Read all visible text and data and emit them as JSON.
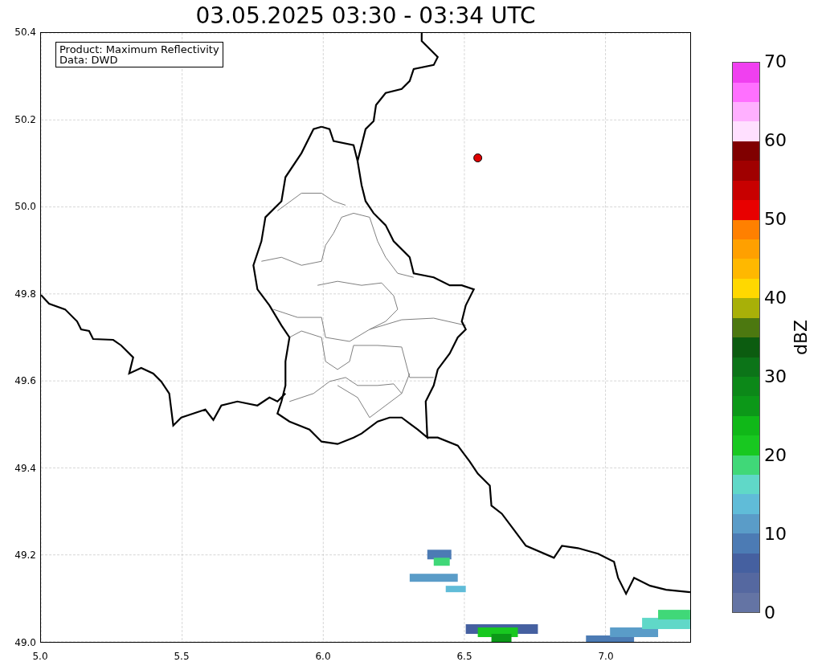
{
  "title": "03.05.2025 03:30 - 03:34 UTC",
  "map": {
    "legend": [
      "Product: Maximum Reflectivity",
      "Data: DWD"
    ],
    "xticks": [
      "5.0",
      "5.5",
      "6.0",
      "6.5",
      "7.0"
    ],
    "yticks": [
      "50.4",
      "50.2",
      "50.0",
      "49.8",
      "49.6",
      "49.4",
      "49.2",
      "49.0"
    ]
  },
  "colorbar": {
    "label": "dBZ",
    "ticks": [
      "70",
      "60",
      "50",
      "40",
      "30",
      "20",
      "10",
      "0"
    ],
    "bins": [
      {
        "color": "#6474a4"
      },
      {
        "color": "#5568a0"
      },
      {
        "color": "#4560a0"
      },
      {
        "color": "#4c7bb4"
      },
      {
        "color": "#5a9cc8"
      },
      {
        "color": "#60bcd8"
      },
      {
        "color": "#60d8c8"
      },
      {
        "color": "#40d878"
      },
      {
        "color": "#18c820"
      },
      {
        "color": "#10b818"
      },
      {
        "color": "#0c9818"
      },
      {
        "color": "#0c8818"
      },
      {
        "color": "#0c7418"
      },
      {
        "color": "#0c5c10"
      },
      {
        "color": "#4c7810"
      },
      {
        "color": "#a8b008"
      },
      {
        "color": "#ffd800"
      },
      {
        "color": "#ffb800"
      },
      {
        "color": "#ffa000"
      },
      {
        "color": "#ff8000"
      },
      {
        "color": "#e80000"
      },
      {
        "color": "#c80000"
      },
      {
        "color": "#a00000"
      },
      {
        "color": "#800000"
      },
      {
        "color": "#ffe0ff"
      },
      {
        "color": "#ffb0ff"
      },
      {
        "color": "#ff70ff"
      },
      {
        "color": "#f040f0"
      }
    ]
  }
}
